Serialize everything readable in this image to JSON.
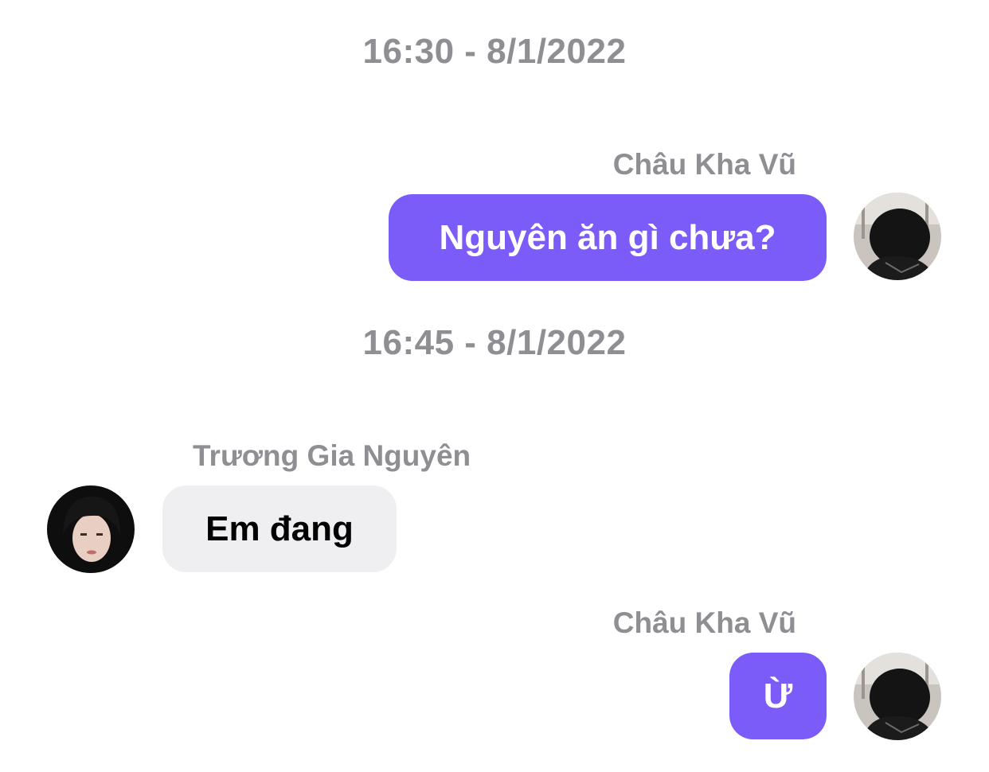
{
  "conversation": {
    "timestamps": [
      "16:30 - 8/1/2022",
      "16:45 - 8/1/2022"
    ],
    "messages": [
      {
        "sender": "Châu Kha Vũ",
        "text": "Nguyên ăn gì chưa?",
        "direction": "outgoing"
      },
      {
        "sender": "Trương Gia Nguyên",
        "text": "Em đang",
        "direction": "incoming"
      },
      {
        "sender": "Châu Kha Vũ",
        "text": "Ừ",
        "direction": "outgoing"
      }
    ]
  },
  "colors": {
    "outgoing_bubble": "#7b5cf8",
    "incoming_bubble": "#efeff2",
    "meta_text": "#8e8e93"
  },
  "icons": {
    "outgoing_avatar": "user-avatar-icon",
    "incoming_avatar": "contact-avatar-icon"
  }
}
